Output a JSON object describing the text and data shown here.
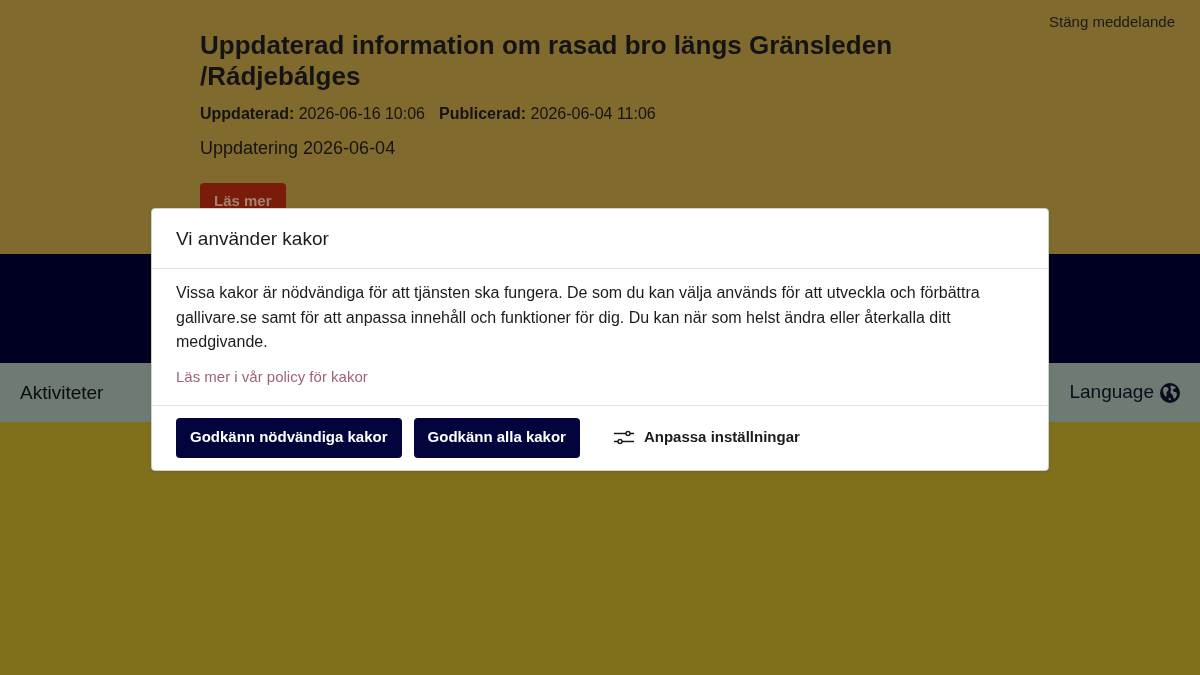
{
  "notice": {
    "close_link": "Stäng meddelande",
    "title": "Uppdaterad information om rasad bro längs Gränsleden /Rádjebálges",
    "meta": [
      "**Uppdaterad:** 2026-06-16 10:06",
      "**Publicerad:** 2026-06-04 11:06"
    ],
    "summary": "Uppdatering 2026-06-04",
    "read_more": "Läs mer"
  },
  "nav": {
    "items": [
      "Aktiviteter"
    ],
    "language": "Language"
  },
  "cookie_dialog": {
    "title": "Vi använder kakor",
    "body": "Vissa kakor är nödvändiga för att tjänsten ska fungera. De som du kan välja används för att utveckla och förbättra gallivare.se samt för att anpassa innehåll och funktioner för dig. Du kan när som helst ändra eller återkalla ditt medgivande.",
    "policy_link": "Läs mer i vår policy för kakor",
    "buttons": [
      {
        "label": "Godkänn nödvändiga kakor",
        "kind": "primary"
      },
      {
        "label": "Godkänn alla kakor",
        "kind": "primary"
      },
      {
        "label": "Anpassa inställningar",
        "kind": "settings"
      }
    ]
  }
}
